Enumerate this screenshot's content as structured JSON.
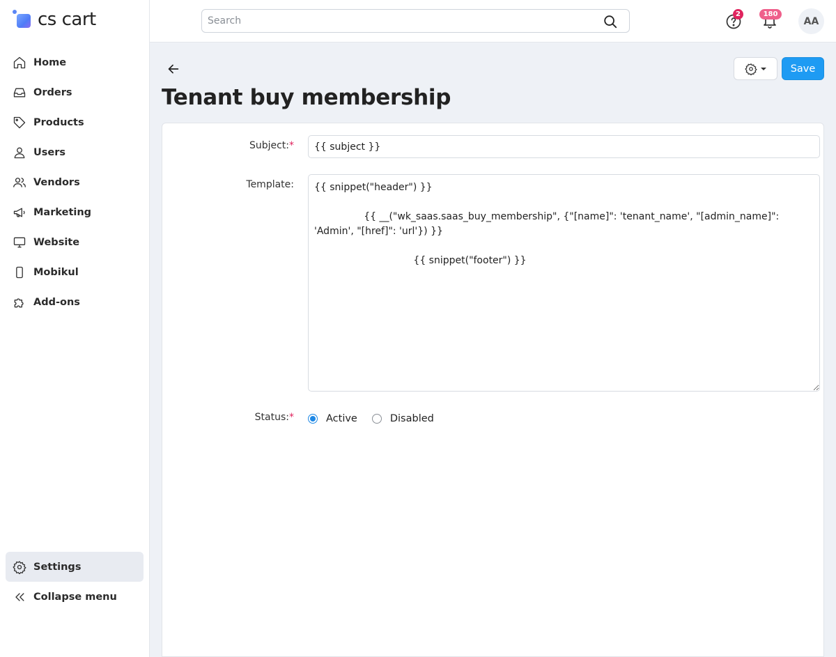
{
  "app": {
    "logo_text": "cs cart"
  },
  "sidebar": {
    "items": [
      {
        "label": "Home",
        "icon": "home-icon"
      },
      {
        "label": "Orders",
        "icon": "inbox-icon"
      },
      {
        "label": "Products",
        "icon": "tag-icon"
      },
      {
        "label": "Users",
        "icon": "user-icon"
      },
      {
        "label": "Vendors",
        "icon": "users-icon"
      },
      {
        "label": "Marketing",
        "icon": "megaphone-icon"
      },
      {
        "label": "Website",
        "icon": "monitor-icon"
      },
      {
        "label": "Mobikul",
        "icon": "smartphone-icon"
      },
      {
        "label": "Add-ons",
        "icon": "puzzle-icon"
      }
    ],
    "bottom_items": [
      {
        "label": "Settings",
        "icon": "gear-icon",
        "active": true
      },
      {
        "label": "Collapse menu",
        "icon": "chevrons-left-icon"
      }
    ]
  },
  "topbar": {
    "search_placeholder": "Search",
    "search_value": "",
    "help_badge": "2",
    "notifications_badge": "180",
    "avatar_initials": "AA"
  },
  "header": {
    "title": "Tenant buy membership",
    "save_label": "Save"
  },
  "form": {
    "subject_label": "Subject:",
    "subject_required": "*",
    "subject_value": "{{ subject }}",
    "template_label": "Template:",
    "template_value": "{{ snippet(\"header\") }}\n\n                {{ __(\"wk_saas.saas_buy_membership\", {\"[name]\": 'tenant_name', \"[admin_name]\": 'Admin', \"[href]\": 'url'}) }}\n\n                                {{ snippet(\"footer\") }}",
    "status_label": "Status:",
    "status_required": "*",
    "status_options": [
      {
        "label": "Active",
        "checked": true
      },
      {
        "label": "Disabled",
        "checked": false
      }
    ]
  },
  "colors": {
    "accent": "#1e9bf3",
    "badge": "#e0245e",
    "background": "#eef1f6"
  }
}
